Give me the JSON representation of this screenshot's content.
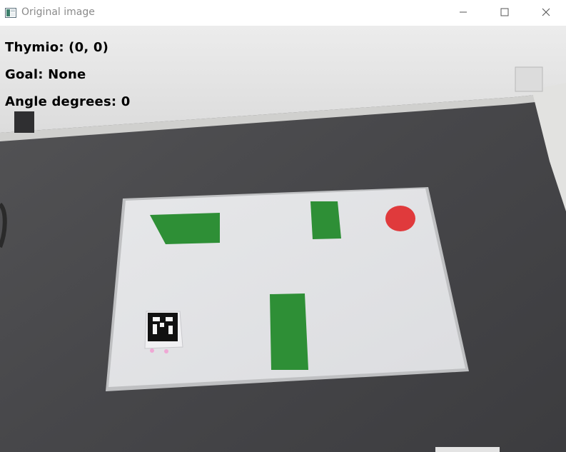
{
  "window": {
    "title": "Original image"
  },
  "overlay": {
    "thymio": "Thymio: (0, 0)",
    "goal": "Goal: None",
    "angle": "Angle degrees: 0"
  },
  "colors": {
    "floor": "#4a4a4c",
    "wall": "#e6e6e4",
    "board": "#e2e3e5",
    "obstacle": "#2e8f36",
    "goal_marker": "#e03a3c"
  },
  "icons": {
    "app": "window-app-icon",
    "minimize": "minimize-icon",
    "maximize": "maximize-icon",
    "close": "close-icon"
  }
}
